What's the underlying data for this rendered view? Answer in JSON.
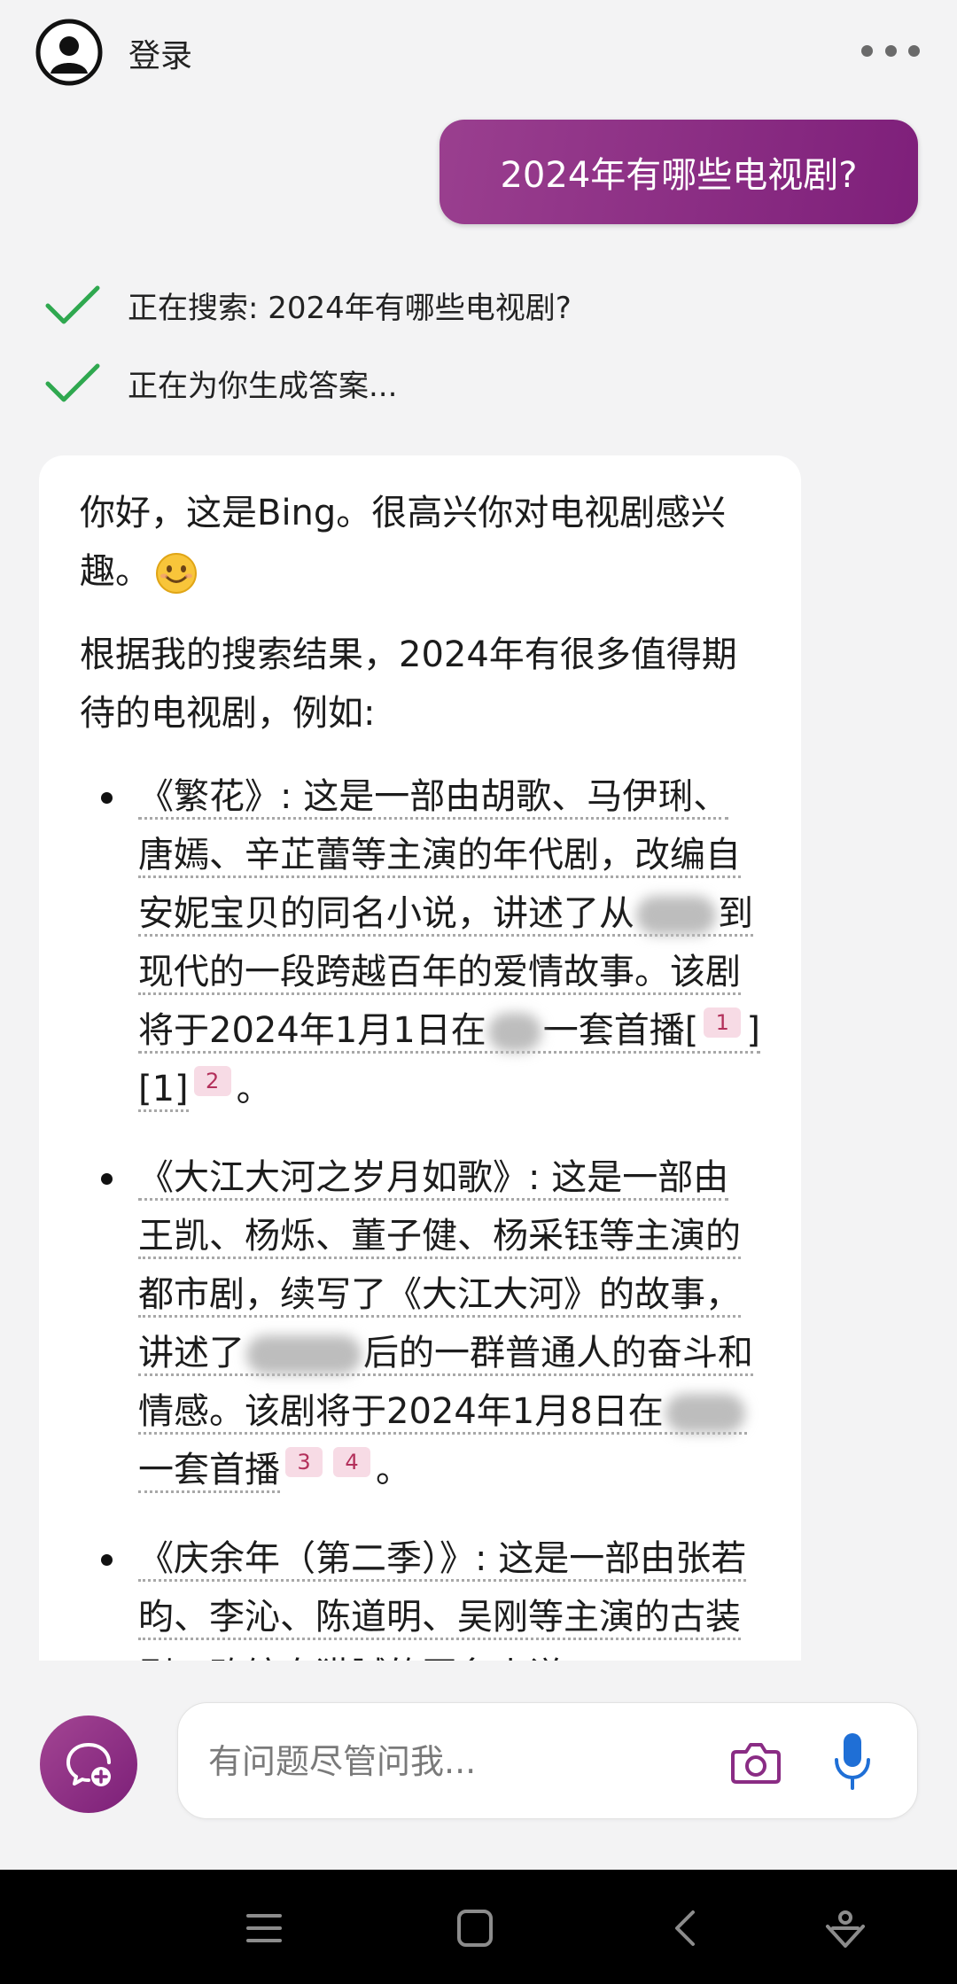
{
  "header": {
    "login_label": "登录"
  },
  "user_message": "2024年有哪些电视剧?",
  "status": [
    {
      "text": "正在搜索: 2024年有哪些电视剧?"
    },
    {
      "text": "正在为你生成答案..."
    }
  ],
  "answer": {
    "greeting": "你好，这是Bing。很高兴你对电视剧感兴趣。",
    "intro": "根据我的搜索结果，2024年有很多值得期待的电视剧，例如:",
    "items": [
      {
        "text_a": "《繁花》: 这是一部由胡歌、马伊琍、唐嫣、辛芷蕾等主演的年代剧，改编自安妮宝贝的同名小说，讲述了从",
        "text_b": "到现代的一段跨越百年的爱情故事。该剧将于2024年1月1日在",
        "text_c": "一套首播[",
        "ref_1": "1",
        "text_d": "][1]",
        "ref_2": "2",
        "end": "。"
      },
      {
        "text_a": "《大江大河之岁月如歌》: 这是一部由王凯、杨烁、董子健、杨采钰等主演的都市剧，续写了《大江大河》的故事，讲述了",
        "text_b": "后的一群普通人的奋斗和情感。该剧将于2024年1月8日在",
        "text_c": "一套首播",
        "ref_1": "3",
        "ref_2": "4",
        "end": "。"
      },
      {
        "text_a": "《庆余年（第二季）》: 这是一部由张若昀、李沁、陈道明、吴刚等主演",
        "text_b": "的古装剧，改编自猫腻的同名小说"
      }
    ]
  },
  "input": {
    "placeholder": "有问题尽管问我..."
  },
  "colors": {
    "accent": "#8a2c84",
    "check": "#2fa84f",
    "mic": "#1f6fd6",
    "ref_bg": "#f7dbe5"
  }
}
